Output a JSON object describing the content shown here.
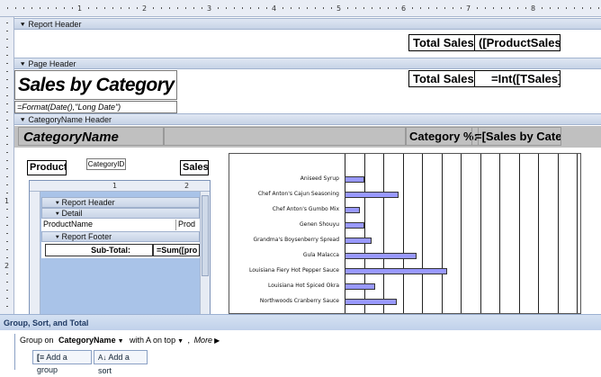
{
  "ruler": {
    "numbers": [
      "1",
      "2",
      "3",
      "4",
      "5",
      "6",
      "7",
      "8"
    ],
    "left_numbers": [
      "1",
      "2"
    ]
  },
  "sections": {
    "report_header": "Report Header",
    "page_header": "Page Header",
    "category_header": "CategoryName Header"
  },
  "report_header": {
    "total_label": "Total Sales:",
    "total_value": "([ProductSales])"
  },
  "page_header": {
    "title": "Sales by Category",
    "date_expr": "=Format(Date(),\"Long Date\")",
    "total_label": "Total Sales:",
    "total_value": "=Int([TSales])"
  },
  "category_header": {
    "name": "CategoryName",
    "pct_label": "Category %:",
    "pct_value": "=[Sales by Categ"
  },
  "detail": {
    "product_label": "Product:",
    "category_id": "CategoryID",
    "sales_label": "Sales:"
  },
  "subreport": {
    "ruler_numbers": [
      "1",
      "2"
    ],
    "report_header": "Report Header",
    "detail": "Detail",
    "product_field": "ProductName",
    "product_field2": "Prod",
    "report_footer": "Report Footer",
    "subtotal_label": "Sub-Total:",
    "subtotal_value": "=Sum([pro"
  },
  "chart_data": {
    "type": "bar",
    "orientation": "horizontal",
    "categories": [
      "Aniseed Syrup",
      "Chef Anton's Cajun Seasoning",
      "Chef Anton's Gumbo Mix",
      "Genen Shouyu",
      "Grandma's Boysenberry Spread",
      "Gula Malacca",
      "Louisiana Fiery Hot Pepper Sauce",
      "Louisiana Hot Spiced Okra",
      "Northwoods Cranberry Sauce"
    ],
    "values": [
      1.0,
      2.8,
      0.8,
      1.0,
      1.4,
      3.7,
      5.3,
      1.6,
      2.7
    ],
    "xlim": [
      0,
      12
    ],
    "grid": true,
    "bar_color": "#9999ff"
  },
  "group_sort": {
    "title": "Group, Sort, and Total",
    "group_on": "Group on",
    "field": "CategoryName",
    "order": "with A on top",
    "more": "More",
    "add_group": "Add a group",
    "add_sort": "Add a sort"
  }
}
